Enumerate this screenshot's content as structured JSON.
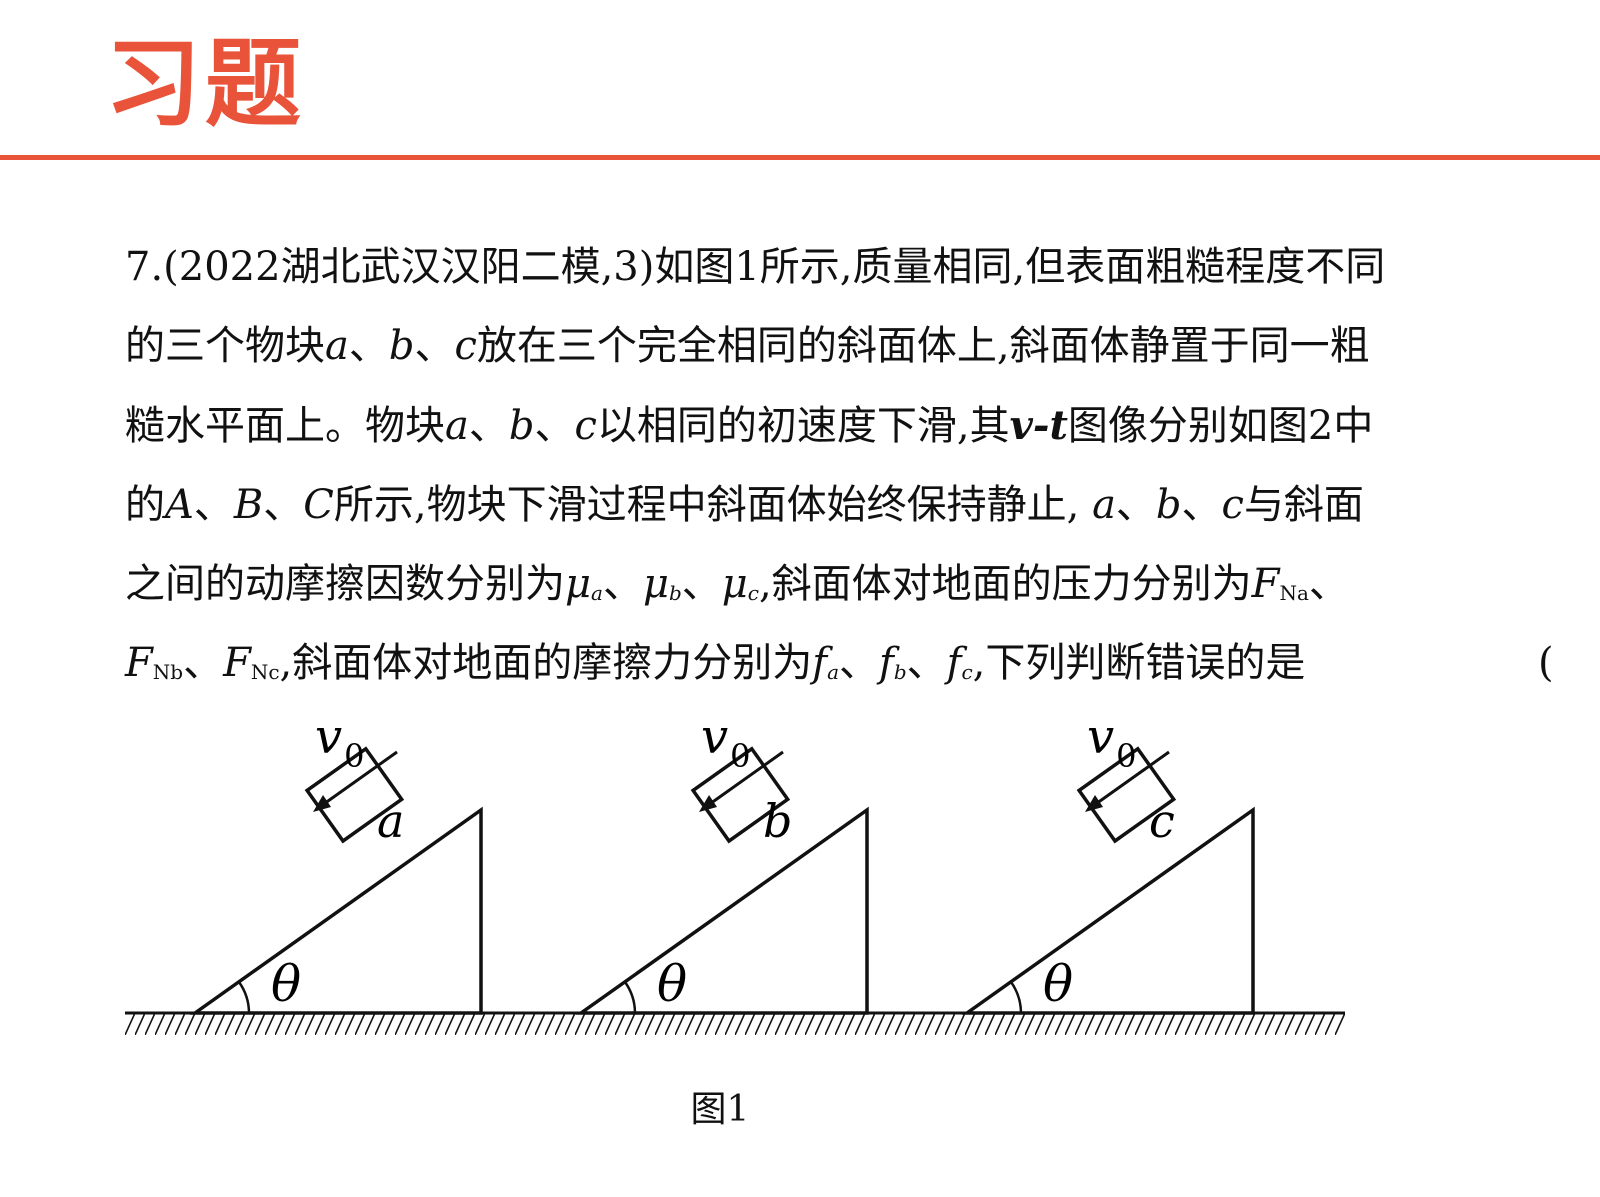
{
  "heading": "习题",
  "colors": {
    "accent": "#e8533a",
    "text": "#111111"
  },
  "problem": {
    "lead": "7.(2022湖北武汉汉阳二模,3)如图1所示,质量相同,但表面粗糙程度不同",
    "l2_a": "的三个物块",
    "l2_b": "放在三个完全相同的斜面体上,斜面体静置于同一粗",
    "l3_a": "糙水平面上。物块",
    "l3_b": "以相同的初速度下滑,其",
    "l3_c": "图像分别如图2中",
    "l4_a": "的",
    "l4_b": "所示,物块下滑过程中斜面体始终保持静止,",
    "l4_c": "与斜面",
    "l5_a": "之间的动摩擦因数分别为",
    "l5_b": ",斜面体对地面的压力分别为",
    "l6_a": ",斜面体对地面的摩擦力分别为",
    "l6_b": ",下列判断错误的是",
    "paren_open": "(",
    "paren_close": ")",
    "sep": "、",
    "comma": ",",
    "sym_a": "a",
    "sym_b": "b",
    "sym_c": "c",
    "sym_A": "A",
    "sym_B": "B",
    "sym_C": "C",
    "sym_vt": "v-t",
    "mu": "μ",
    "F": "F",
    "f": "f",
    "sub_a": "a",
    "sub_b": "b",
    "sub_c": "c",
    "sub_Na": "Na",
    "sub_Nb": "Nb",
    "sub_Nc": "Nc"
  },
  "figure": {
    "caption": "图1",
    "velocity_label": "v",
    "velocity_sub": "0",
    "angle_label": "θ",
    "blocks": [
      "a",
      "b",
      "c"
    ]
  }
}
